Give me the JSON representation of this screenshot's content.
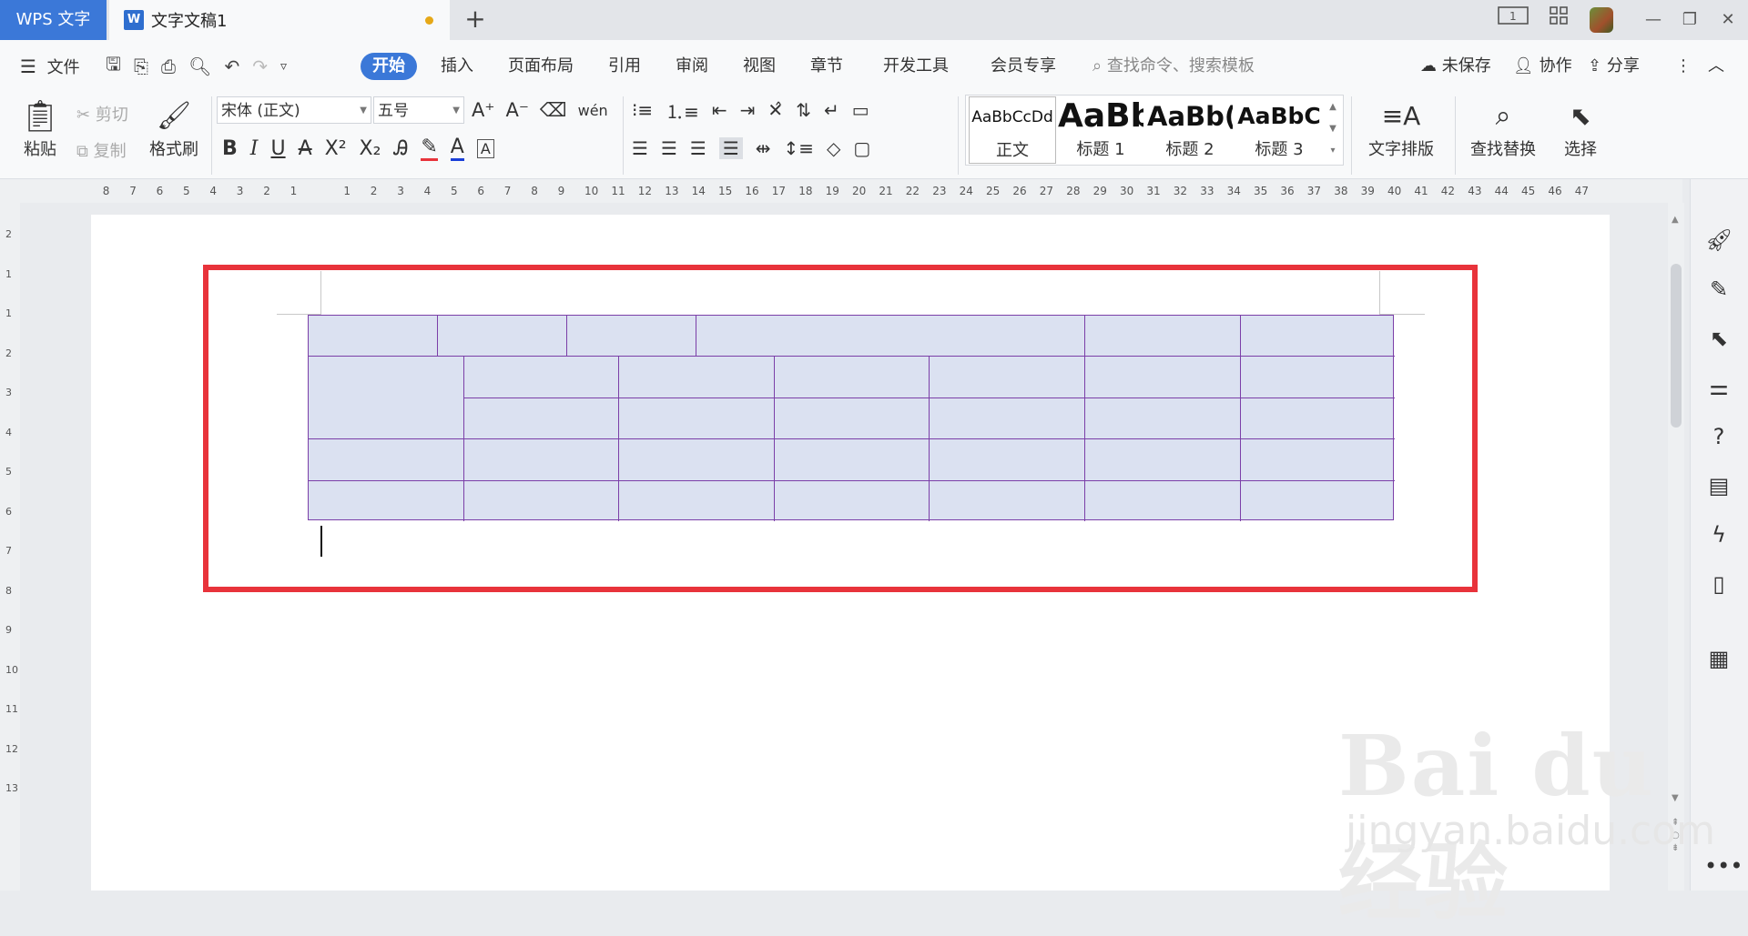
{
  "titlebar": {
    "app_name": "WPS 文字",
    "doc_title": "文字文稿1",
    "new_tab": "+",
    "layout_icon_label": "1"
  },
  "menubar": {
    "file": "文件",
    "tabs": [
      "开始",
      "插入",
      "页面布局",
      "引用",
      "审阅",
      "视图",
      "章节",
      "开发工具",
      "会员专享"
    ],
    "search_placeholder": "查找命令、搜索模板",
    "unsaved": "未保存",
    "collaborate": "协作",
    "share": "分享"
  },
  "ribbon": {
    "paste": "粘贴",
    "cut": "剪切",
    "copy": "复制",
    "format_painter": "格式刷",
    "font_name": "宋体 (正文)",
    "font_size": "五号",
    "styles": [
      {
        "sample": "AaBbCcDd",
        "name": "正文"
      },
      {
        "sample": "AaBb",
        "name": "标题 1"
      },
      {
        "sample": "AaBb(",
        "name": "标题 2"
      },
      {
        "sample": "AaBbC",
        "name": "标题 3"
      }
    ],
    "text_layout": "文字排版",
    "find_replace": "查找替换",
    "select": "选择"
  },
  "ruler": {
    "h_left": [
      "8",
      "7",
      "6",
      "5",
      "4",
      "3",
      "2",
      "1"
    ],
    "h_right": [
      "1",
      "2",
      "3",
      "4",
      "5",
      "6",
      "7",
      "8",
      "9",
      "10",
      "11",
      "12",
      "13",
      "14",
      "15",
      "16",
      "17",
      "18",
      "19",
      "20",
      "21",
      "22",
      "23",
      "24",
      "25",
      "26",
      "27",
      "28",
      "29",
      "30",
      "31",
      "32",
      "33",
      "34",
      "35",
      "36",
      "37",
      "38",
      "39",
      "40",
      "41",
      "42",
      "43",
      "44",
      "45",
      "46",
      "47"
    ],
    "v_labels": [
      "2",
      "1",
      "1",
      "2",
      "3",
      "4",
      "5",
      "6",
      "7",
      "8",
      "9",
      "10",
      "11",
      "12",
      "13"
    ]
  },
  "watermark": {
    "brand": "Bai du 经验",
    "url": "jingyan.baidu.com"
  },
  "colors": {
    "accent": "#3b78d8",
    "table_fill": "#dbe1f1",
    "table_border": "#7b3fa8",
    "highlight": "#e8333b"
  }
}
